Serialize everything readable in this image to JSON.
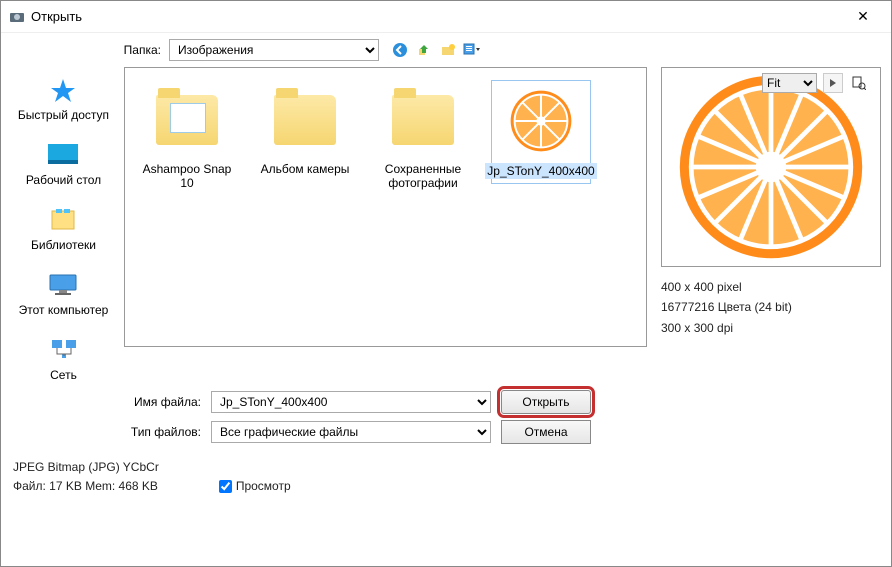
{
  "window": {
    "title": "Открыть"
  },
  "folder": {
    "label": "Папка:",
    "current": "Изображения"
  },
  "fit": {
    "value": "Fit"
  },
  "sidebar": {
    "items": [
      {
        "label": "Быстрый доступ"
      },
      {
        "label": "Рабочий стол"
      },
      {
        "label": "Библиотеки"
      },
      {
        "label": "Этот компьютер"
      },
      {
        "label": "Сеть"
      }
    ]
  },
  "files": {
    "items": [
      {
        "label": "Ashampoo Snap 10"
      },
      {
        "label": "Альбом камеры"
      },
      {
        "label": "Сохраненные фотографии"
      },
      {
        "label": "Jp_STonY_400x400"
      }
    ]
  },
  "preview": {
    "dimensions": "400 x 400 pixel",
    "colors": "16777216 Цвета (24 bit)",
    "dpi": "300 x 300 dpi"
  },
  "fields": {
    "filename_label": "Имя файла:",
    "filename_value": "Jp_STonY_400x400",
    "filetype_label": "Тип файлов:",
    "filetype_value": "Все графические файлы",
    "open_label": "Открыть",
    "cancel_label": "Отмена"
  },
  "status": {
    "format": "JPEG Bitmap (JPG) YCbCr",
    "file_mem": "Файл: 17 KB   Mem: 468 KB",
    "preview_check": "Просмотр"
  }
}
